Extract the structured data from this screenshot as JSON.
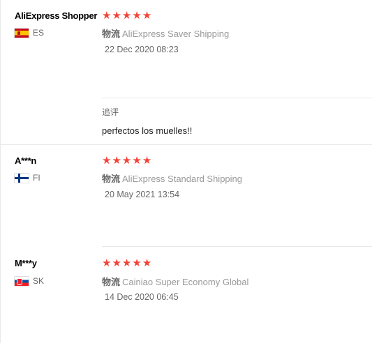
{
  "reviews": [
    {
      "user": "AliExpress Shopper",
      "country_code": "ES",
      "rating": 5,
      "shipping_label": "物流",
      "shipping_method": "AliExpress Saver Shipping",
      "date": "22 Dec 2020 08:23",
      "followup_label": "追评",
      "followup_text": "perfectos los muelles!!"
    },
    {
      "user": "A***n",
      "country_code": "FI",
      "rating": 5,
      "shipping_label": "物流",
      "shipping_method": "AliExpress Standard Shipping",
      "date": "20 May 2021 13:54"
    },
    {
      "user": "M***y",
      "country_code": "SK",
      "rating": 5,
      "shipping_label": "物流",
      "shipping_method": "Cainiao Super Economy Global",
      "date": "14 Dec 2020 06:45"
    }
  ],
  "colors": {
    "star": "#f44336",
    "divider": "#e8e8e8"
  },
  "star_glyph": "★"
}
